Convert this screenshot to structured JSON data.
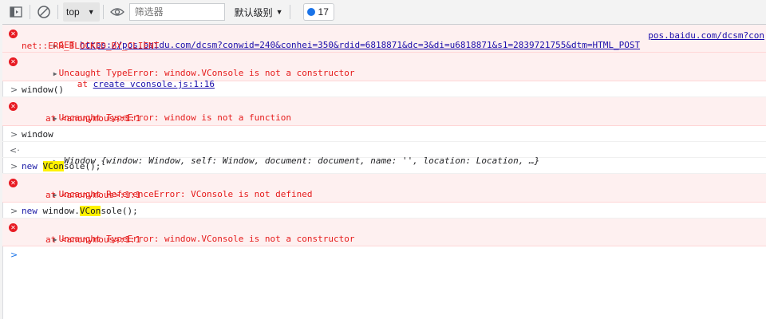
{
  "toolbar": {
    "context": "top",
    "filter_placeholder": "筛选器",
    "levels_label": "默认级别",
    "message_count": "17"
  },
  "messages": {
    "m1": {
      "method": "GET",
      "url": "https://pos.baidu.com/dcsm?conwid=240&conhei=350&rdid=6818871&dc=3&di=u6818871&s1=2839721755&dtm=HTML_POST",
      "error": "net::ERR_BLOCKED_BY_CLIENT",
      "source": "pos.baidu.com/dcsm?con"
    },
    "m2": {
      "text": "Uncaught TypeError: window.VConsole is not a constructor",
      "at_prefix": "at ",
      "at_link": "create vconsole.js:1:16"
    },
    "m3": {
      "input": "window()"
    },
    "m4": {
      "text": "Uncaught TypeError: window is not a function",
      "at": "at <anonymous>:1:1"
    },
    "m5": {
      "input": "window"
    },
    "m6": {
      "output": "Window {window: Window, self: Window, document: document, name: '', location: Location, …}"
    },
    "m7": {
      "kw": "new",
      "pre": "",
      "hl": "VCon",
      "post": "sole();"
    },
    "m8": {
      "text": "Uncaught ReferenceError: VConsole is not defined",
      "at": "at <anonymous>:1:1"
    },
    "m9": {
      "kw": "new",
      "pre": "window.",
      "hl": "VCon",
      "post": "sole();"
    },
    "m10": {
      "text": "Uncaught TypeError: window.VConsole is not a constructor",
      "at": "at <anonymous>:1:1"
    }
  },
  "icons": {
    "toggle_sidebar": "sidebar-icon",
    "clear": "clear-console-icon",
    "live_expression": "eye-icon",
    "error": "error-icon",
    "message_badge": "message-icon"
  },
  "colors": {
    "error_text": "#e51b1b",
    "error_bg": "#fef0f0",
    "highlight": "#fff200",
    "link": "#1a0dab",
    "accent": "#1a73e8"
  }
}
